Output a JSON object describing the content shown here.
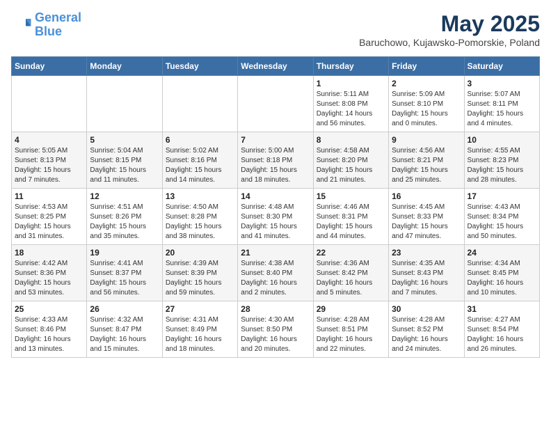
{
  "header": {
    "logo_line1": "General",
    "logo_line2": "Blue",
    "month": "May 2025",
    "location": "Baruchowo, Kujawsko-Pomorskie, Poland"
  },
  "weekdays": [
    "Sunday",
    "Monday",
    "Tuesday",
    "Wednesday",
    "Thursday",
    "Friday",
    "Saturday"
  ],
  "weeks": [
    [
      {
        "day": "",
        "info": ""
      },
      {
        "day": "",
        "info": ""
      },
      {
        "day": "",
        "info": ""
      },
      {
        "day": "",
        "info": ""
      },
      {
        "day": "1",
        "info": "Sunrise: 5:11 AM\nSunset: 8:08 PM\nDaylight: 14 hours\nand 56 minutes."
      },
      {
        "day": "2",
        "info": "Sunrise: 5:09 AM\nSunset: 8:10 PM\nDaylight: 15 hours\nand 0 minutes."
      },
      {
        "day": "3",
        "info": "Sunrise: 5:07 AM\nSunset: 8:11 PM\nDaylight: 15 hours\nand 4 minutes."
      }
    ],
    [
      {
        "day": "4",
        "info": "Sunrise: 5:05 AM\nSunset: 8:13 PM\nDaylight: 15 hours\nand 7 minutes."
      },
      {
        "day": "5",
        "info": "Sunrise: 5:04 AM\nSunset: 8:15 PM\nDaylight: 15 hours\nand 11 minutes."
      },
      {
        "day": "6",
        "info": "Sunrise: 5:02 AM\nSunset: 8:16 PM\nDaylight: 15 hours\nand 14 minutes."
      },
      {
        "day": "7",
        "info": "Sunrise: 5:00 AM\nSunset: 8:18 PM\nDaylight: 15 hours\nand 18 minutes."
      },
      {
        "day": "8",
        "info": "Sunrise: 4:58 AM\nSunset: 8:20 PM\nDaylight: 15 hours\nand 21 minutes."
      },
      {
        "day": "9",
        "info": "Sunrise: 4:56 AM\nSunset: 8:21 PM\nDaylight: 15 hours\nand 25 minutes."
      },
      {
        "day": "10",
        "info": "Sunrise: 4:55 AM\nSunset: 8:23 PM\nDaylight: 15 hours\nand 28 minutes."
      }
    ],
    [
      {
        "day": "11",
        "info": "Sunrise: 4:53 AM\nSunset: 8:25 PM\nDaylight: 15 hours\nand 31 minutes."
      },
      {
        "day": "12",
        "info": "Sunrise: 4:51 AM\nSunset: 8:26 PM\nDaylight: 15 hours\nand 35 minutes."
      },
      {
        "day": "13",
        "info": "Sunrise: 4:50 AM\nSunset: 8:28 PM\nDaylight: 15 hours\nand 38 minutes."
      },
      {
        "day": "14",
        "info": "Sunrise: 4:48 AM\nSunset: 8:30 PM\nDaylight: 15 hours\nand 41 minutes."
      },
      {
        "day": "15",
        "info": "Sunrise: 4:46 AM\nSunset: 8:31 PM\nDaylight: 15 hours\nand 44 minutes."
      },
      {
        "day": "16",
        "info": "Sunrise: 4:45 AM\nSunset: 8:33 PM\nDaylight: 15 hours\nand 47 minutes."
      },
      {
        "day": "17",
        "info": "Sunrise: 4:43 AM\nSunset: 8:34 PM\nDaylight: 15 hours\nand 50 minutes."
      }
    ],
    [
      {
        "day": "18",
        "info": "Sunrise: 4:42 AM\nSunset: 8:36 PM\nDaylight: 15 hours\nand 53 minutes."
      },
      {
        "day": "19",
        "info": "Sunrise: 4:41 AM\nSunset: 8:37 PM\nDaylight: 15 hours\nand 56 minutes."
      },
      {
        "day": "20",
        "info": "Sunrise: 4:39 AM\nSunset: 8:39 PM\nDaylight: 15 hours\nand 59 minutes."
      },
      {
        "day": "21",
        "info": "Sunrise: 4:38 AM\nSunset: 8:40 PM\nDaylight: 16 hours\nand 2 minutes."
      },
      {
        "day": "22",
        "info": "Sunrise: 4:36 AM\nSunset: 8:42 PM\nDaylight: 16 hours\nand 5 minutes."
      },
      {
        "day": "23",
        "info": "Sunrise: 4:35 AM\nSunset: 8:43 PM\nDaylight: 16 hours\nand 7 minutes."
      },
      {
        "day": "24",
        "info": "Sunrise: 4:34 AM\nSunset: 8:45 PM\nDaylight: 16 hours\nand 10 minutes."
      }
    ],
    [
      {
        "day": "25",
        "info": "Sunrise: 4:33 AM\nSunset: 8:46 PM\nDaylight: 16 hours\nand 13 minutes."
      },
      {
        "day": "26",
        "info": "Sunrise: 4:32 AM\nSunset: 8:47 PM\nDaylight: 16 hours\nand 15 minutes."
      },
      {
        "day": "27",
        "info": "Sunrise: 4:31 AM\nSunset: 8:49 PM\nDaylight: 16 hours\nand 18 minutes."
      },
      {
        "day": "28",
        "info": "Sunrise: 4:30 AM\nSunset: 8:50 PM\nDaylight: 16 hours\nand 20 minutes."
      },
      {
        "day": "29",
        "info": "Sunrise: 4:28 AM\nSunset: 8:51 PM\nDaylight: 16 hours\nand 22 minutes."
      },
      {
        "day": "30",
        "info": "Sunrise: 4:28 AM\nSunset: 8:52 PM\nDaylight: 16 hours\nand 24 minutes."
      },
      {
        "day": "31",
        "info": "Sunrise: 4:27 AM\nSunset: 8:54 PM\nDaylight: 16 hours\nand 26 minutes."
      }
    ]
  ]
}
